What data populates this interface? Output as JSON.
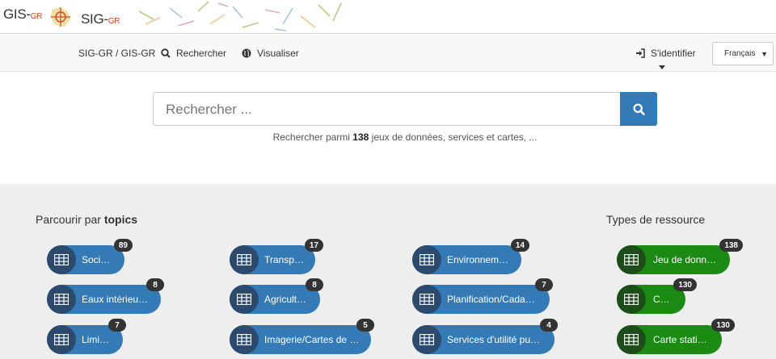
{
  "header": {
    "logo_gis_main": "GIS-",
    "logo_gis_small": "GR",
    "logo_sig_main": "SIG-",
    "logo_sig_small": "GR"
  },
  "nav": {
    "home": "SIG-GR / GIS-GR",
    "search": "Rechercher",
    "visualize": "Visualiser",
    "login": "S'identifier",
    "language": "Français"
  },
  "search": {
    "placeholder": "Rechercher ...",
    "hint_before": "Rechercher parmi ",
    "hint_count": "138",
    "hint_after": " jeux de données, services et cartes, ..."
  },
  "topics": {
    "title_prefix": "Parcourir par ",
    "title_bold": "topics",
    "items": [
      {
        "label": "Société",
        "count": "89"
      },
      {
        "label": "Transport",
        "count": "17"
      },
      {
        "label": "Environnement",
        "count": "14"
      },
      {
        "label": "Eaux intérieures",
        "count": "8"
      },
      {
        "label": "Agriculture",
        "count": "8"
      },
      {
        "label": "Planification/Cadastre",
        "count": "7"
      },
      {
        "label": "Limites",
        "count": "7"
      },
      {
        "label": "Imagerie/Cartes de …",
        "count": "5"
      },
      {
        "label": "Services d'utilité pub…",
        "count": "4"
      }
    ]
  },
  "resource_types": {
    "title": "Types de ressource",
    "items": [
      {
        "label": "Jeu de données",
        "count": "138"
      },
      {
        "label": "Carte",
        "count": "130"
      },
      {
        "label": "Carte statique",
        "count": "130"
      }
    ]
  },
  "colors": {
    "primary": "#337ab7",
    "success": "#1a8a12",
    "badge": "#333333"
  },
  "icons": {
    "search": "search-icon",
    "visualize": "globe-icon",
    "login": "sign-in-icon",
    "pill": "table-icon"
  }
}
